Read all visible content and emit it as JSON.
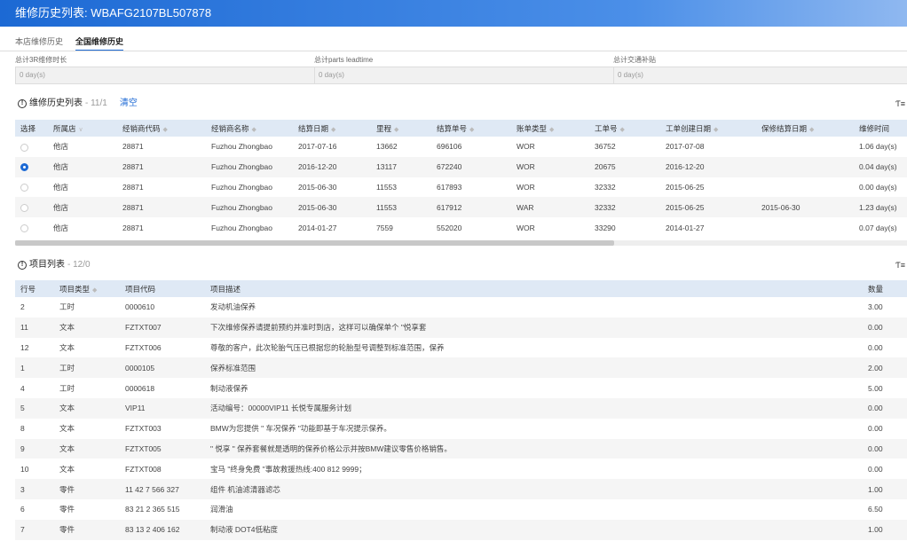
{
  "window": {
    "title": "维修历史列表: WBAFG2107BL507878"
  },
  "tabs": [
    {
      "label": "本店维修历史",
      "active": false
    },
    {
      "label": "全国维修历史",
      "active": true
    }
  ],
  "summary": [
    {
      "label": "总计3R维修时长",
      "value": "0 day(s)"
    },
    {
      "label": "总计parts leadtime",
      "value": "0 day(s)"
    },
    {
      "label": "总计交通补贴",
      "value": "0 day(s)"
    }
  ],
  "history": {
    "title": "维修历史列表",
    "count": "- 11/1",
    "clear_label": "清空",
    "columns": [
      "选择",
      "所属店",
      "经销商代码",
      "经销商名称",
      "结算日期",
      "里程",
      "结算单号",
      "账单类型",
      "工单号",
      "工单创建日期",
      "保修结算日期",
      "维修时间"
    ],
    "rows": [
      {
        "selected": false,
        "store": "他店",
        "dealer_code": "28871",
        "dealer_name": "Fuzhou Zhongbao",
        "settle_date": "2017-07-16",
        "mileage": "13662",
        "settle_no": "696106",
        "bill_type": "WOR",
        "order_no": "36752",
        "order_date": "2017-07-08",
        "warranty_date": "",
        "repair_time": "1.06 day(s)"
      },
      {
        "selected": true,
        "store": "他店",
        "dealer_code": "28871",
        "dealer_name": "Fuzhou Zhongbao",
        "settle_date": "2016-12-20",
        "mileage": "13117",
        "settle_no": "672240",
        "bill_type": "WOR",
        "order_no": "20675",
        "order_date": "2016-12-20",
        "warranty_date": "",
        "repair_time": "0.04 day(s)"
      },
      {
        "selected": false,
        "store": "他店",
        "dealer_code": "28871",
        "dealer_name": "Fuzhou Zhongbao",
        "settle_date": "2015-06-30",
        "mileage": "11553",
        "settle_no": "617893",
        "bill_type": "WOR",
        "order_no": "32332",
        "order_date": "2015-06-25",
        "warranty_date": "",
        "repair_time": "0.00 day(s)"
      },
      {
        "selected": false,
        "store": "他店",
        "dealer_code": "28871",
        "dealer_name": "Fuzhou Zhongbao",
        "settle_date": "2015-06-30",
        "mileage": "11553",
        "settle_no": "617912",
        "bill_type": "WAR",
        "order_no": "32332",
        "order_date": "2015-06-25",
        "warranty_date": "2015-06-30",
        "repair_time": "1.23 day(s)"
      },
      {
        "selected": false,
        "store": "他店",
        "dealer_code": "28871",
        "dealer_name": "Fuzhou Zhongbao",
        "settle_date": "2014-01-27",
        "mileage": "7559",
        "settle_no": "552020",
        "bill_type": "WOR",
        "order_no": "33290",
        "order_date": "2014-01-27",
        "warranty_date": "",
        "repair_time": "0.07 day(s)"
      }
    ]
  },
  "items": {
    "title": "项目列表",
    "count": "- 12/0",
    "columns": [
      "行号",
      "项目类型",
      "项目代码",
      "项目描述",
      "数量"
    ],
    "rows": [
      {
        "line": "2",
        "type": "工时",
        "code": "0000610",
        "desc": "发动机油保养",
        "qty": "3.00"
      },
      {
        "line": "11",
        "type": "文本",
        "code": "FZTXT007",
        "desc": "下次维修保养请提前预约并准时到店，这样可以确保单个 \"悦享套",
        "qty": "0.00"
      },
      {
        "line": "12",
        "type": "文本",
        "code": "FZTXT006",
        "desc": "尊敬的客户，此次轮胎气压已根据您的轮胎型号调整到标准范围，保养",
        "qty": "0.00"
      },
      {
        "line": "1",
        "type": "工时",
        "code": "0000105",
        "desc": "保养标准范围",
        "qty": "2.00"
      },
      {
        "line": "4",
        "type": "工时",
        "code": "0000618",
        "desc": "制动液保养",
        "qty": "5.00"
      },
      {
        "line": "5",
        "type": "文本",
        "code": "VIP11",
        "desc": "活动编号：00000VIP11 长悦专属服务计划",
        "qty": "0.00"
      },
      {
        "line": "8",
        "type": "文本",
        "code": "FZTXT003",
        "desc": "BMW为您提供 \" 车况保养 \"功能即基于车况提示保养。",
        "qty": "0.00"
      },
      {
        "line": "9",
        "type": "文本",
        "code": "FZTXT005",
        "desc": "\" 悦享 \" 保养套餐就是透明的保养价格公示并按BMW建议零售价格销售。",
        "qty": "0.00"
      },
      {
        "line": "10",
        "type": "文本",
        "code": "FZTXT008",
        "desc": "宝马 \"终身免费 \"事故救援热线:400 812 9999；",
        "qty": "0.00"
      },
      {
        "line": "3",
        "type": "零件",
        "code": "11 42 7 566 327",
        "desc": "组件 机油滤清器滤芯",
        "qty": "1.00"
      },
      {
        "line": "6",
        "type": "零件",
        "code": "83 21 2 365 515",
        "desc": "润滑油",
        "qty": "6.50"
      },
      {
        "line": "7",
        "type": "零件",
        "code": "83 13 2 406 162",
        "desc": "制动液 DOT4低粘度",
        "qty": "1.00"
      }
    ]
  },
  "icons": {
    "info": "info-circle-icon",
    "filter": "filter-icon",
    "sort": "sort-icon",
    "chevron": "chevron-down-icon"
  }
}
